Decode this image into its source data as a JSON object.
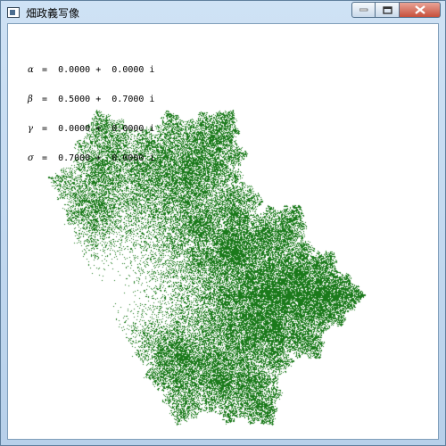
{
  "window": {
    "title": "畑政義写像",
    "minimize_icon": "minimize-icon",
    "maximize_icon": "maximize-icon",
    "close_icon": "close-icon"
  },
  "parameters": [
    {
      "symbol": "α",
      "value": " =  0.0000 +  0.0000 i"
    },
    {
      "symbol": "β",
      "value": " =  0.5000 +  0.7000 i"
    },
    {
      "symbol": "γ",
      "value": " =  0.0000 +  0.0000 i"
    },
    {
      "symbol": "σ",
      "value": " =  0.7000 +  0.0000 i"
    }
  ],
  "fractal": {
    "color": "#1a7a1a"
  },
  "colors": {
    "close_button": "#c7503c",
    "fractal_green": "#1a7a1a"
  }
}
